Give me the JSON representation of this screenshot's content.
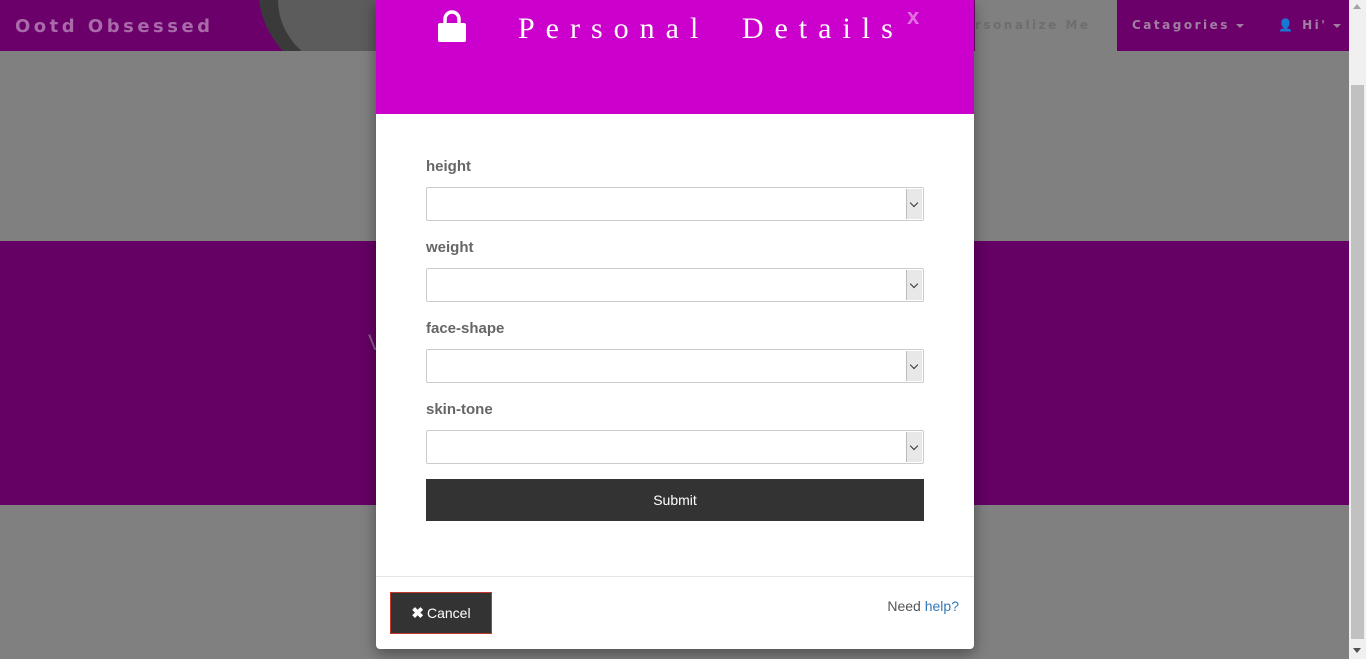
{
  "nav": {
    "brand": "Ootd Obsessed",
    "personalize": "rsonalize Me",
    "categories": "Catagories",
    "user": "Hi'"
  },
  "hero": {
    "letter": "V"
  },
  "modal": {
    "title": "Personal Details",
    "close": "x",
    "fields": [
      {
        "label": "height",
        "value": ""
      },
      {
        "label": "weight",
        "value": ""
      },
      {
        "label": "face-shape",
        "value": ""
      },
      {
        "label": "skin-tone",
        "value": ""
      }
    ],
    "submit": "Submit",
    "cancel": "Cancel",
    "help_prefix": "Need",
    "help_link": "help?"
  },
  "colors": {
    "header": "#cc00cc",
    "navbar": "#6b006b",
    "band": "#650065",
    "button": "#333333",
    "link": "#337ab7"
  },
  "icons": [
    "lock-icon",
    "close-icon",
    "times-icon",
    "user-icon",
    "chevron-down-icon"
  ]
}
